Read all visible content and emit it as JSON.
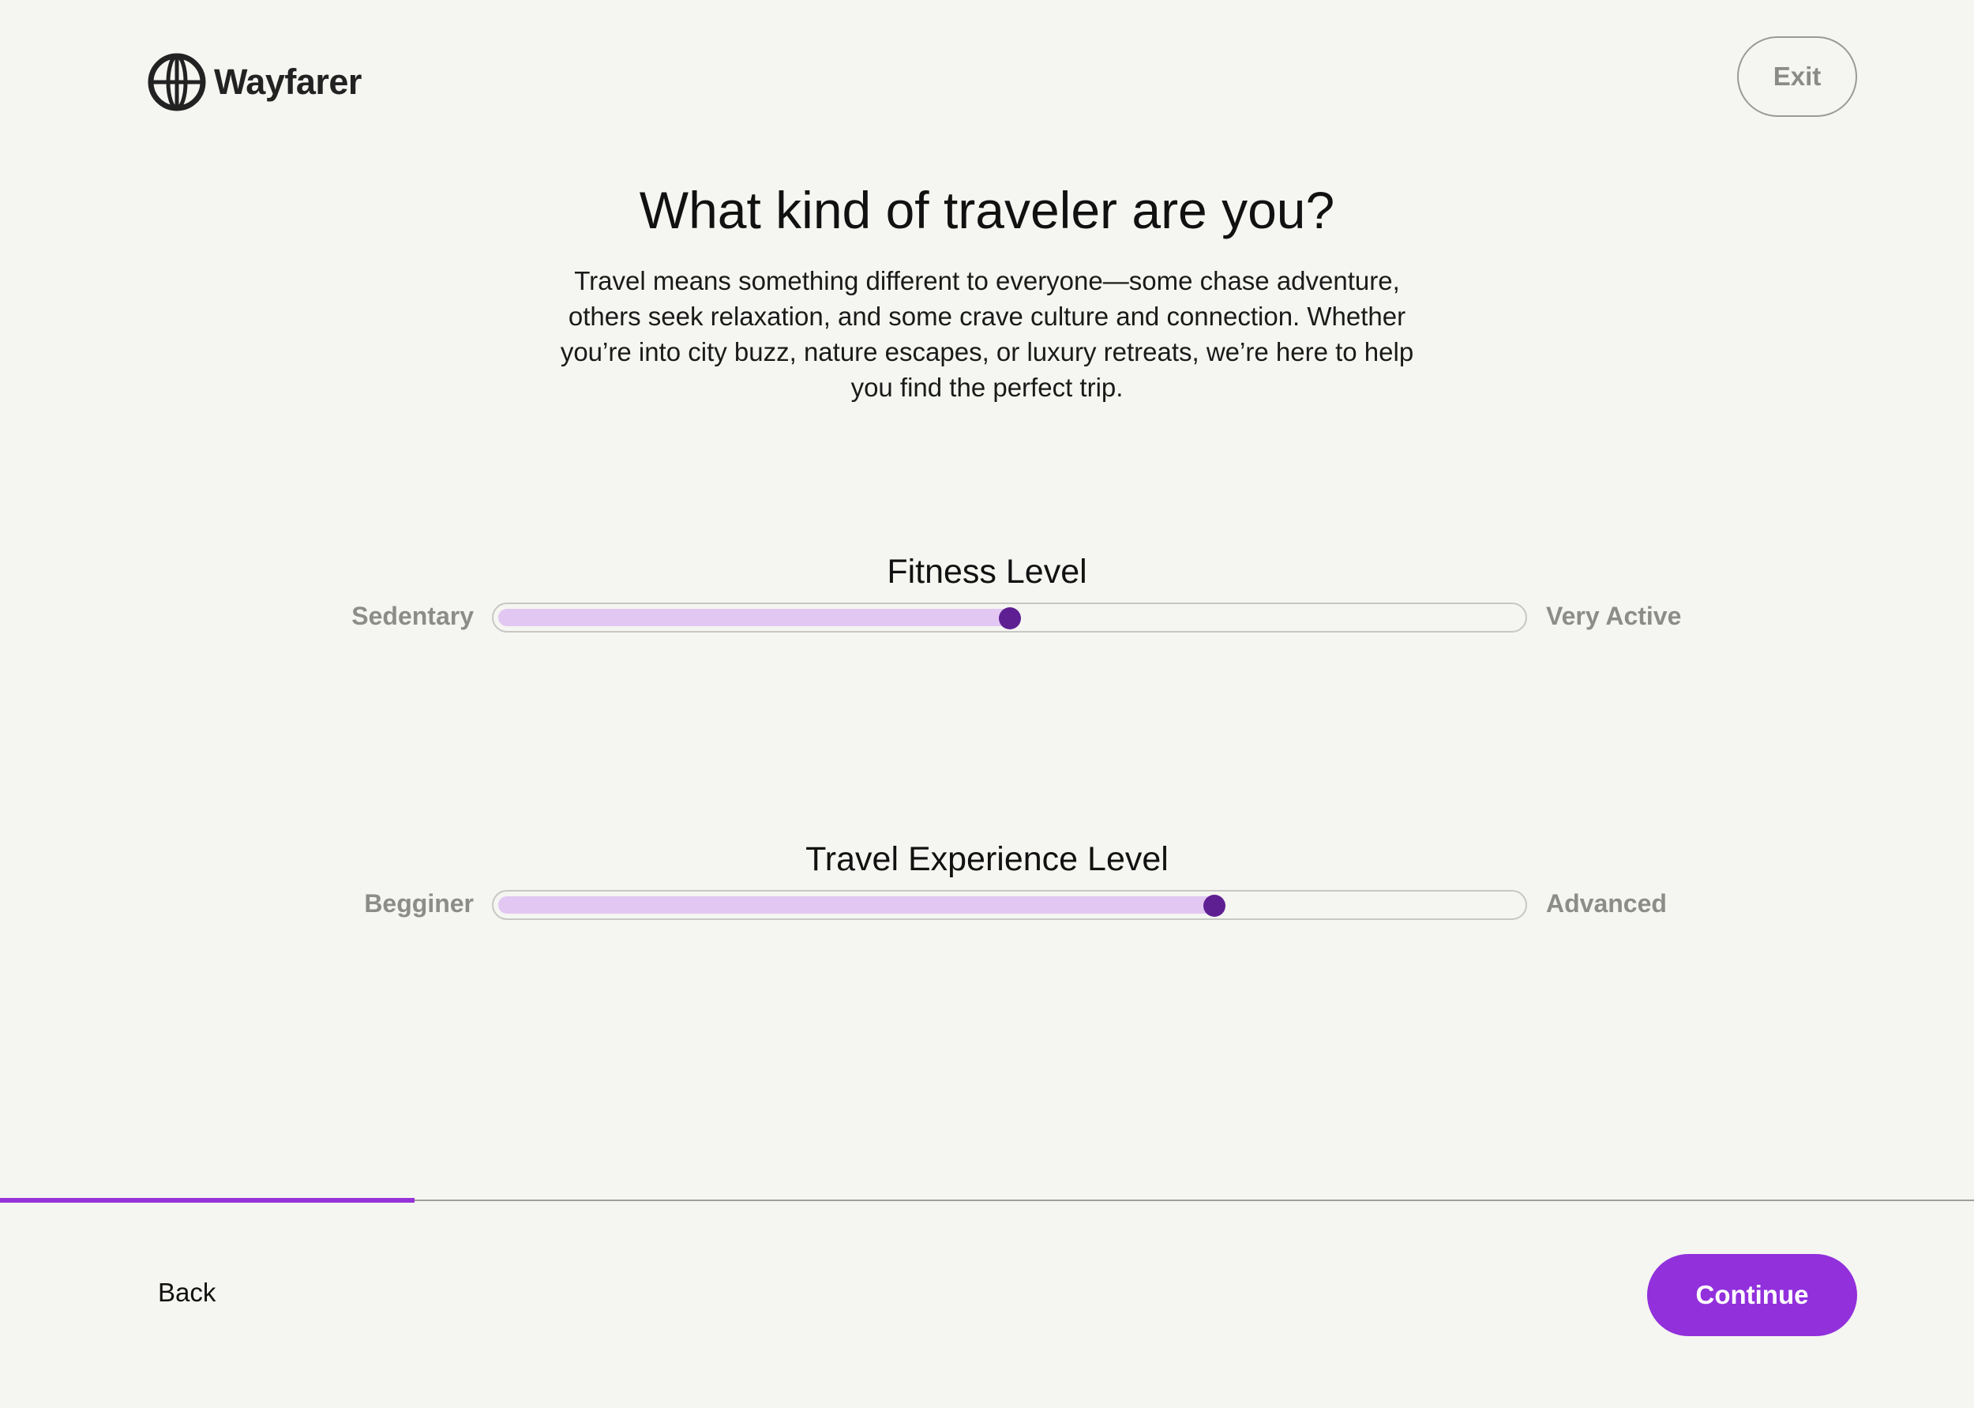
{
  "brand": {
    "name": "Wayfarer",
    "logo_icon": "globe-icon"
  },
  "header": {
    "exit_label": "Exit"
  },
  "main": {
    "title": "What kind of traveler are you?",
    "description": "Travel means something different to everyone—some chase adventure, others seek relaxation, and some crave culture and connection. Whether you’re into city buzz, nature escapes, or luxury retreats, we’re here to help you find the perfect trip."
  },
  "sliders": [
    {
      "title": "Fitness Level",
      "min_label": "Sedentary",
      "max_label": "Very Active",
      "value": 0.5
    },
    {
      "title": "Travel Experience Level",
      "min_label": "Begginer",
      "max_label": "Advanced",
      "value": 0.7
    }
  ],
  "progress": {
    "value": 0.21
  },
  "footer": {
    "back_label": "Back",
    "continue_label": "Continue"
  },
  "colors": {
    "accent": "#9230dc",
    "slider_fill": "#e2c7f3",
    "slider_thumb": "#5e1f93",
    "background": "#f5f5f1"
  }
}
